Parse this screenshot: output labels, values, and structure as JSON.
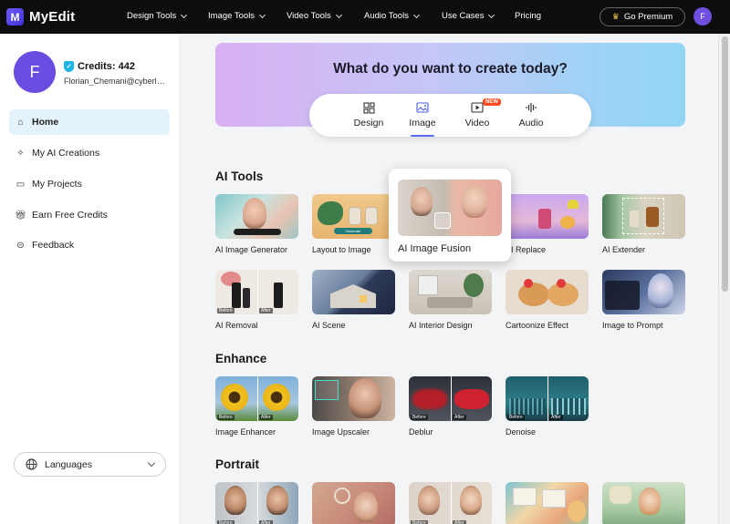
{
  "app": {
    "logo_text": "MyEdit",
    "logo_letter": "M"
  },
  "nav": {
    "items": [
      "Design Tools",
      "Image Tools",
      "Video Tools",
      "Audio Tools",
      "Use Cases",
      "Pricing"
    ],
    "premium_label": "Go Premium",
    "avatar_letter": "F"
  },
  "sidebar": {
    "avatar_letter": "F",
    "credits": "Credits: 442",
    "email": "Florian_Chemani@cyberlink.com",
    "items": [
      {
        "label": "Home",
        "icon": "home-icon"
      },
      {
        "label": "My AI Creations",
        "icon": "sparkle-icon"
      },
      {
        "label": "My Projects",
        "icon": "folder-icon"
      },
      {
        "label": "Earn Free Credits",
        "icon": "gift-icon"
      },
      {
        "label": "Feedback",
        "icon": "chat-icon"
      }
    ],
    "language_label": "Languages"
  },
  "hero": {
    "title": "What do you want to create today?",
    "tabs": [
      "Design",
      "Image",
      "Video",
      "Audio"
    ],
    "active_tab": "Image",
    "new_badge": "NEW"
  },
  "sections": {
    "ai_tools": {
      "title": "AI Tools",
      "row1": [
        "AI Image Generator",
        "Layout to Image",
        "AI Image Fusion",
        "AI Replace",
        "AI Extender"
      ],
      "row2": [
        "AI Removal",
        "AI Scene",
        "AI Interior Design",
        "Cartoonize Effect",
        "Image to Prompt"
      ]
    },
    "enhance": {
      "title": "Enhance",
      "items": [
        "Image Enhancer",
        "Image Upscaler",
        "Deblur",
        "Denoise"
      ]
    },
    "portrait": {
      "title": "Portrait"
    }
  },
  "thumb_text": {
    "before": "Before",
    "after": "After",
    "generate": "Generate",
    "replace_label": "AI Replace"
  },
  "colors": {
    "accent": "#5b6cf0",
    "avatar": "#6a4ce0",
    "active_bg": "#e4f3fb",
    "new_badge": "#ff4a1f"
  }
}
